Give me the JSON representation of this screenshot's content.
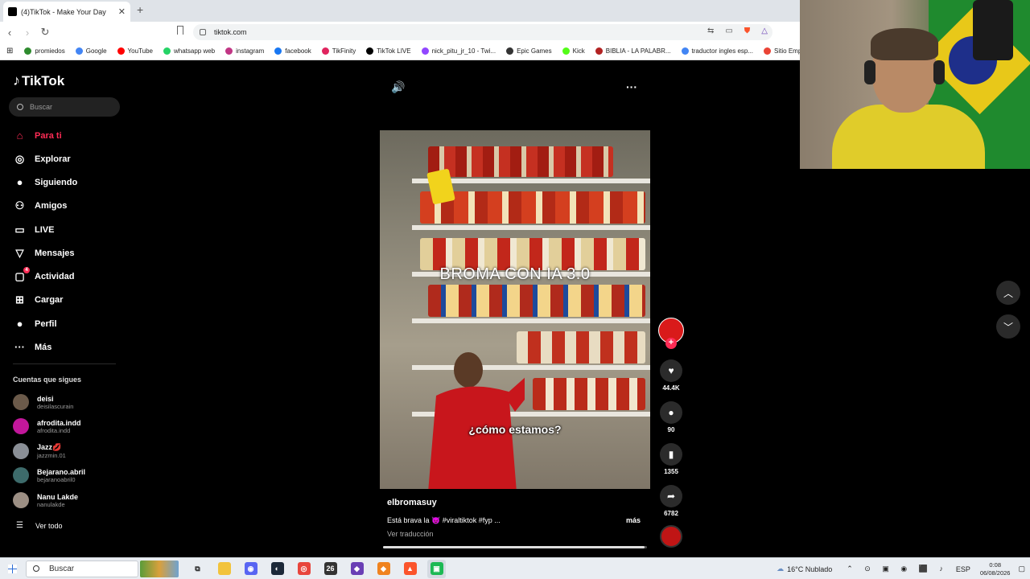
{
  "browser": {
    "tab_title": "(4)TikTok - Make Your Day",
    "tab_close": "✕",
    "new_tab": "+",
    "url": "tiktok.com",
    "bookmarks": [
      {
        "label": "promiedos",
        "color": "#2e8b2e"
      },
      {
        "label": "Google",
        "color": "#4285f4"
      },
      {
        "label": "YouTube",
        "color": "#ff0000"
      },
      {
        "label": "whatsapp web",
        "color": "#25d366"
      },
      {
        "label": "instagram",
        "color": "#c13584"
      },
      {
        "label": "facebook",
        "color": "#1877f2"
      },
      {
        "label": "TikFinity",
        "color": "#e0245e"
      },
      {
        "label": "TikTok LIVE",
        "color": "#000000"
      },
      {
        "label": "nick_pitu_jr_10 - Twi...",
        "color": "#9146ff"
      },
      {
        "label": "Epic Games",
        "color": "#333333"
      },
      {
        "label": "Kick",
        "color": "#53fc18"
      },
      {
        "label": "BIBLIA - LA PALABR...",
        "color": "#b22222"
      },
      {
        "label": "traductor ingles esp...",
        "color": "#4285f4"
      },
      {
        "label": "Sitio Emp",
        "color": "#ea4335"
      }
    ]
  },
  "tiktok": {
    "logo_text": "TikTok",
    "search_placeholder": "Buscar",
    "menu": [
      {
        "label": "Para ti",
        "icon": "home-icon",
        "glyph": "⌂",
        "active": true
      },
      {
        "label": "Explorar",
        "icon": "compass-icon",
        "glyph": "◎",
        "active": false
      },
      {
        "label": "Siguiendo",
        "icon": "following-icon",
        "glyph": "●",
        "active": false
      },
      {
        "label": "Amigos",
        "icon": "friends-icon",
        "glyph": "⚇",
        "active": false
      },
      {
        "label": "LIVE",
        "icon": "live-icon",
        "glyph": "▭",
        "active": false
      },
      {
        "label": "Mensajes",
        "icon": "messages-icon",
        "glyph": "▽",
        "active": false
      },
      {
        "label": "Actividad",
        "icon": "activity-icon",
        "glyph": "▢",
        "active": false,
        "badge": "4"
      },
      {
        "label": "Cargar",
        "icon": "upload-icon",
        "glyph": "⊞",
        "active": false
      },
      {
        "label": "Perfil",
        "icon": "profile-icon",
        "glyph": "●",
        "active": false
      },
      {
        "label": "Más",
        "icon": "more-icon",
        "glyph": "···",
        "active": false
      }
    ],
    "following_title": "Cuentas que sigues",
    "following": [
      {
        "name": "deisi",
        "handle": "deisilascurain",
        "color": "#6b5a4a"
      },
      {
        "name": "afrodita.indd",
        "handle": "afrodita.indd",
        "color": "#c2179b"
      },
      {
        "name": "Jazz💋",
        "handle": "jazzmin.01",
        "color": "#8a8f96"
      },
      {
        "name": "Bejarano.abril",
        "handle": "bejaranoabril0",
        "color": "#3d6b6b"
      },
      {
        "name": "Nanu Lakde",
        "handle": "nanulakde",
        "color": "#9c8f84"
      }
    ],
    "see_all": "Ver todo",
    "video": {
      "overlay_title": "BROMA CON IA 3.0",
      "overlay_subtitle": "¿cómo estamos?",
      "username": "elbromasuy",
      "caption": "Está brava la 😈 #viraltiktok #fyp ...",
      "more": "más",
      "translate": "Ver traducción",
      "progress": 0.99
    },
    "actions": {
      "likes": "44.4K",
      "comments": "90",
      "saves": "1355",
      "shares": "6782"
    }
  },
  "taskbar": {
    "search": "Buscar",
    "weather": "16°C  Nublado",
    "language": "ESP",
    "time": "0:08",
    "date": "06/08/2026",
    "apps": [
      {
        "name": "task-view-icon",
        "glyph": "⧉",
        "bg": "transparent",
        "fg": "#222"
      },
      {
        "name": "file-explorer-icon",
        "glyph": "▬",
        "bg": "#f2c33c",
        "fg": "#f2c33c"
      },
      {
        "name": "discord-icon",
        "glyph": "◉",
        "bg": "#5865f2",
        "fg": "#fff"
      },
      {
        "name": "steam-icon",
        "glyph": "◐",
        "bg": "#1b2838",
        "fg": "#fff"
      },
      {
        "name": "chrome-icon",
        "glyph": "◎",
        "bg": "#e8453c",
        "fg": "#fff"
      },
      {
        "name": "app-26-icon",
        "glyph": "26",
        "bg": "#333",
        "fg": "#fff"
      },
      {
        "name": "app-purple-icon",
        "glyph": "◆",
        "bg": "#6a3fb5",
        "fg": "#fff"
      },
      {
        "name": "app-orange-icon",
        "glyph": "◆",
        "bg": "#f0831f",
        "fg": "#fff"
      },
      {
        "name": "brave-icon",
        "glyph": "▲",
        "bg": "#fb542b",
        "fg": "#fff"
      },
      {
        "name": "app-green-icon",
        "glyph": "▣",
        "bg": "#1db954",
        "fg": "#fff"
      }
    ]
  }
}
